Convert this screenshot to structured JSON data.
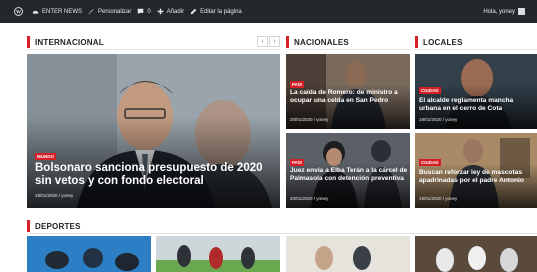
{
  "adminbar": {
    "site_name": "ENTER NEWS",
    "customize": "Personalizar",
    "comments_count": "0",
    "add_new": "Añadir",
    "edit_page": "Editar la página",
    "greeting": "Hola, yoney"
  },
  "sections": {
    "internacional": "INTERNACIONAL",
    "nacionales": "NACIONALES",
    "locales": "LOCALES",
    "deportes": "DEPORTES"
  },
  "carousel": {
    "prev": "‹",
    "next": "›"
  },
  "main_story": {
    "category": "MUNDO",
    "title": "Bolsonaro sanciona presupuesto de 2020 sin vetos y con fondo electoral",
    "date": "19/01/2020",
    "author": "yoney"
  },
  "nacionales": [
    {
      "category": "PAÍS",
      "title": "La caída de Romero: de ministro a ocupar una celda en San Pedro",
      "date": "20/01/2020",
      "author": "yoney"
    },
    {
      "category": "PAÍS",
      "title": "Juez envía a Elba Terán a la cárcel de Palmasola con detención preventiva",
      "date": "20/01/2020",
      "author": "yoney"
    }
  ],
  "locales": [
    {
      "category": "CIUDAD",
      "title": "El alcalde reglamenta mancha urbana en el cerro de Cota",
      "date": "19/01/2020",
      "author": "yoney"
    },
    {
      "category": "CIUDAD",
      "title": "Buscan reforzar ley de mascotas apadrinadas por el padre Antonio",
      "date": "19/01/2020",
      "author": "yoney"
    }
  ],
  "meta_separator": " / ",
  "colors": {
    "accent": "#d51f26",
    "adminbar": "#23282d"
  }
}
